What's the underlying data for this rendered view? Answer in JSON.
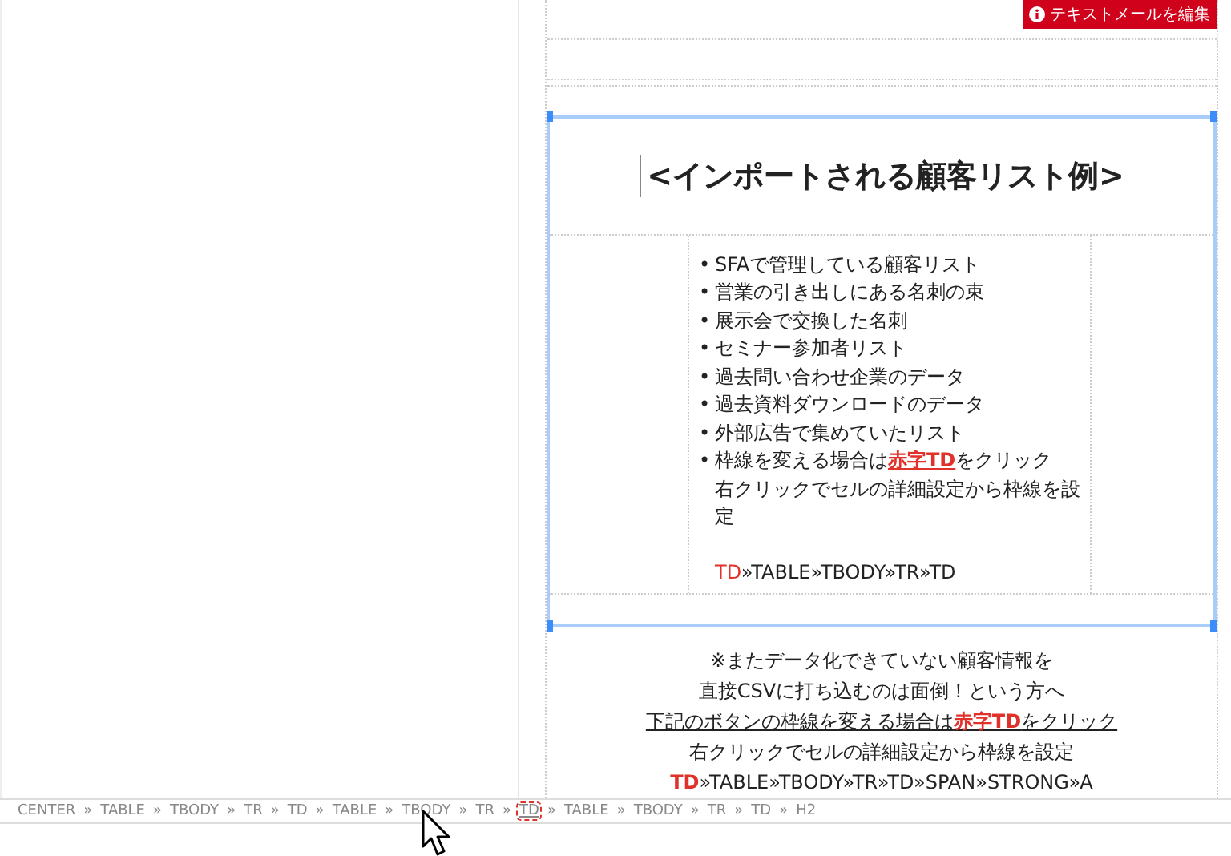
{
  "badge": {
    "label": "テキストメールを編集"
  },
  "heading": "<インポートされる顧客リスト例>",
  "list": [
    {
      "text": "SFAで管理している顧客リスト"
    },
    {
      "text": "営業の引き出しにある名刺の束"
    },
    {
      "text": "展示会で交換した名刺"
    },
    {
      "text": "セミナー参加者リスト"
    },
    {
      "text": "過去問い合わせ企業のデータ"
    },
    {
      "text": "過去資料ダウンロードのデータ"
    },
    {
      "text": "外部広告で集めていたリスト"
    },
    {
      "text": "枠線を変える場合は**赤字TD**をクリック",
      "note": "右クリックでセルの詳細設定から枠線を設定"
    }
  ],
  "path_line": {
    "head": "TD",
    "rest": "»TABLE»TBODY»TR»TD"
  },
  "notice": [
    {
      "text": "※またデータ化できていない顧客情報を",
      "underline": false
    },
    {
      "text": "直接CSVに打ち込むのは面倒！という方へ",
      "underline": false
    },
    {
      "text": "下記のボタンの枠線を変える場合は**赤字TD**をクリック",
      "underline": true
    },
    {
      "text": "右クリックでセルの詳細設定から枠線を設定",
      "underline": false
    },
    {
      "text": "**TD**»TABLE»TBODY»TR»TD»SPAN»STRONG»A",
      "underline": false
    }
  ],
  "breadcrumb": [
    {
      "label": "CENTER",
      "selected": false
    },
    {
      "label": "TABLE",
      "selected": false
    },
    {
      "label": "TBODY",
      "selected": false
    },
    {
      "label": "TR",
      "selected": false
    },
    {
      "label": "TD",
      "selected": false
    },
    {
      "label": "TABLE",
      "selected": false
    },
    {
      "label": "TBODY",
      "selected": false
    },
    {
      "label": "TR",
      "selected": false
    },
    {
      "label": "TD",
      "selected": true
    },
    {
      "label": "TABLE",
      "selected": false
    },
    {
      "label": "TBODY",
      "selected": false
    },
    {
      "label": "TR",
      "selected": false
    },
    {
      "label": "TD",
      "selected": false
    },
    {
      "label": "H2",
      "selected": false
    }
  ],
  "breadcrumb_separator": "»",
  "list_bullet": "•"
}
